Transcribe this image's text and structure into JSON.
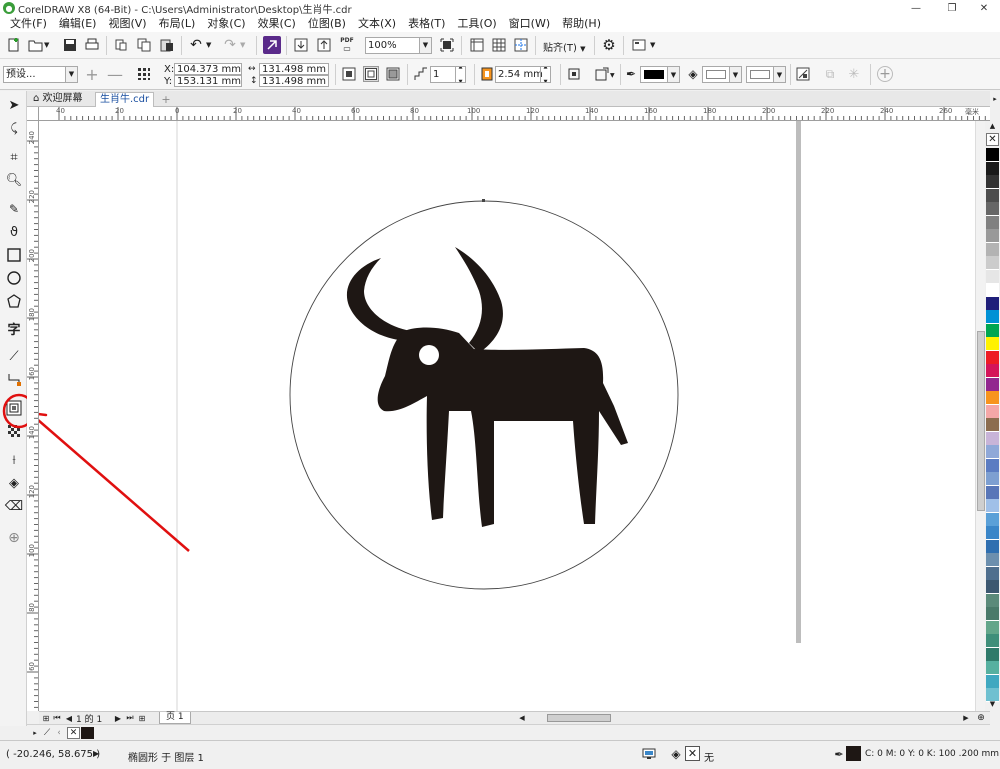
{
  "window": {
    "title": "CorelDRAW X8 (64-Bit) - C:\\Users\\Administrator\\Desktop\\生肖牛.cdr",
    "minimize": "—",
    "restore": "❐",
    "close": "✕"
  },
  "menu": [
    "文件(F)",
    "编辑(E)",
    "视图(V)",
    "布局(L)",
    "对象(C)",
    "效果(C)",
    "位图(B)",
    "文本(X)",
    "表格(T)",
    "工具(O)",
    "窗口(W)",
    "帮助(H)"
  ],
  "toolbar": {
    "pdf_label": "PDF",
    "zoom_value": "100%",
    "snap_label": "贴齐(T)"
  },
  "propertybar": {
    "preset": "预设...",
    "x_label": "X:",
    "x_value": "104.373 mm",
    "y_label": "Y:",
    "y_value": "153.131 mm",
    "width_value": "131.498 mm",
    "height_value": "131.498 mm",
    "step_value": "1",
    "offset_value": "2.54 mm"
  },
  "doctabs": {
    "welcome": "欢迎屏幕",
    "document": "生肖牛.cdr"
  },
  "ruler": {
    "h_labels": [
      "40",
      "20",
      "0",
      "20",
      "40",
      "60",
      "80",
      "100",
      "120",
      "140",
      "160",
      "180",
      "200",
      "220",
      "240",
      "260"
    ],
    "h_unit": "毫米",
    "v_labels": [
      "240",
      "220",
      "200",
      "180",
      "160",
      "140",
      "120",
      "100",
      "80",
      "60"
    ]
  },
  "pagebar": {
    "page_count": "1 的 1",
    "page_tab": "页 1"
  },
  "status": {
    "cursor_coords": "( -20.246, 58.675 )",
    "selection_info": "椭圆形 于 图层 1",
    "fill_none": "无",
    "outline_info": "C: 0 M: 0 Y: 0 K: 100  .200 mm"
  },
  "colors": {
    "accent": "#1a73e8",
    "annotation": "#e01010",
    "ox": "#1e1714",
    "palette": [
      "#000000",
      "#1a1a1a",
      "#333333",
      "#4d4d4d",
      "#666666",
      "#808080",
      "#999999",
      "#b3b3b3",
      "#cccccc",
      "#e6e6e6",
      "#ffffff",
      "#1f1f7a",
      "#0091d5",
      "#00a651",
      "#fff200",
      "#ed1c24",
      "#d4145a",
      "#92278f",
      "#f7941d",
      "#f4a7a7",
      "#8c6d4f",
      "#c8b4d8",
      "#8fa8d8",
      "#5b7cc2",
      "#7d9fd1",
      "#5876b8",
      "#a0c0e8",
      "#5aa0d8",
      "#3a86c8",
      "#2f6fb0",
      "#6c8fae",
      "#4f6f8e",
      "#3d5870",
      "#5b8a7a",
      "#4a7a6a",
      "#63a68a",
      "#3f8f7a",
      "#2f7a6a",
      "#56b0a0",
      "#40a8c0",
      "#6fc0d0"
    ]
  }
}
